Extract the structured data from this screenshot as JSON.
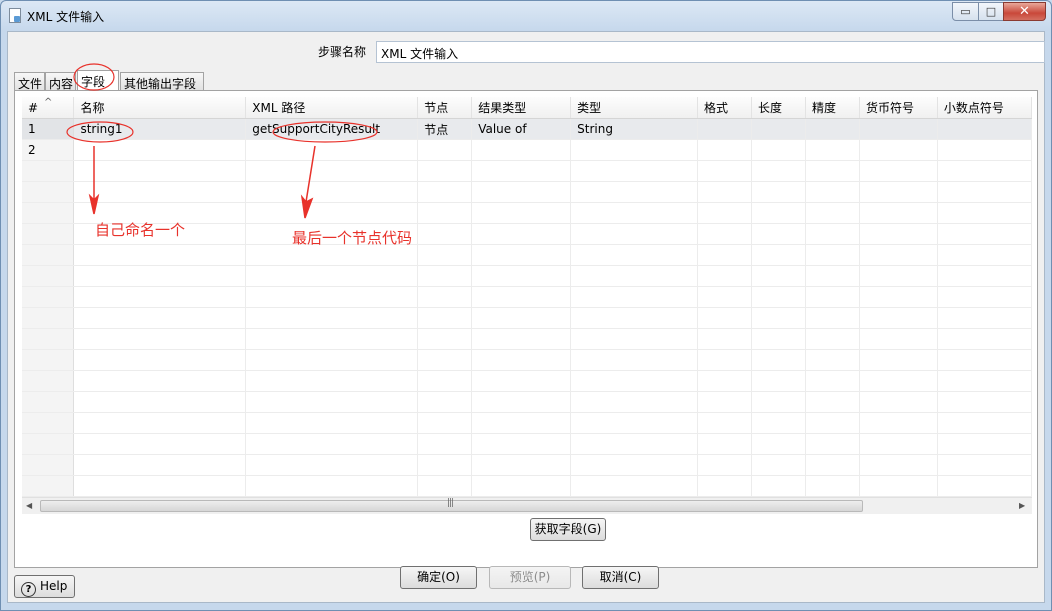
{
  "window": {
    "title": "XML 文件输入",
    "controls": {
      "minimize": "▭",
      "maximize": "□",
      "close": "✕"
    }
  },
  "step": {
    "label": "步骤名称",
    "value": "XML 文件输入"
  },
  "tabs": [
    {
      "label": "文件",
      "active": false
    },
    {
      "label": "内容",
      "active": false
    },
    {
      "label": "字段",
      "active": true
    },
    {
      "label": "其他输出字段",
      "active": false
    }
  ],
  "grid": {
    "sort_glyph": "^",
    "columns": [
      "#",
      "名称",
      "XML 路径",
      "节点",
      "结果类型",
      "类型",
      "格式",
      "长度",
      "精度",
      "货币符号",
      "小数点符号"
    ],
    "rows": [
      {
        "num": "1",
        "cells": [
          "string1",
          "getSupportCityResult",
          "节点",
          "Value of",
          "String",
          "",
          "",
          "",
          "",
          ""
        ]
      },
      {
        "num": "2",
        "cells": [
          "",
          "",
          "",
          "",
          "",
          "",
          "",
          "",
          "",
          ""
        ]
      }
    ],
    "scroll_grip": "|||"
  },
  "buttons": {
    "get_fields": "获取字段(G)",
    "ok": "确定(O)",
    "preview": "预览(P)",
    "cancel": "取消(C)",
    "help": "Help",
    "help_glyph": "?"
  },
  "annotations": {
    "name_note": "自己命名一个",
    "path_note": "最后一个节点代码",
    "color": "#e8322b"
  }
}
